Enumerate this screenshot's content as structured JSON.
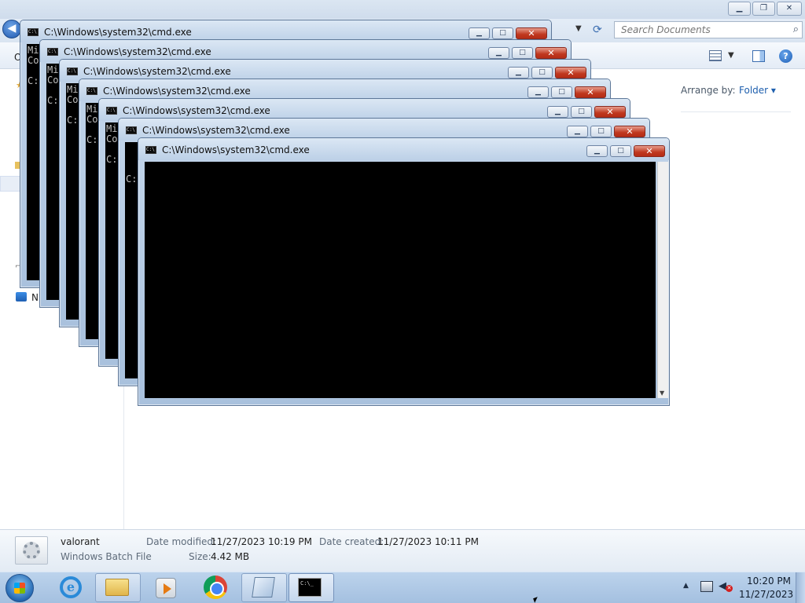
{
  "explorer": {
    "search_placeholder": "Search Documents",
    "organize_fragment": "O",
    "arrange_label": "Arrange by:",
    "arrange_value": "Folder",
    "nav_network_fragment": "N",
    "details": {
      "file_name": "valorant",
      "file_type": "Windows Batch File",
      "date_modified_label": "Date modified:",
      "date_modified": "11/27/2023 10:19 PM",
      "date_created_label": "Date created:",
      "date_created": "11/27/2023 10:11 PM",
      "size_label": "Size:",
      "size": "4.42 MB"
    }
  },
  "cmd_windows": [
    {
      "title": "C:\\Windows\\system32\\cmd.exe",
      "console": "Mi\nCo\n\nC:"
    },
    {
      "title": "C:\\Windows\\system32\\cmd.exe",
      "console": "Mi\nCo\n\nC:"
    },
    {
      "title": "C:\\Windows\\system32\\cmd.exe",
      "console": "Mi\nCo\n\nC:"
    },
    {
      "title": "C:\\Windows\\system32\\cmd.exe",
      "console": "Mi\nCo\n\nC:"
    },
    {
      "title": "C:\\Windows\\system32\\cmd.exe",
      "console": "Mi\nCo\n\nC:"
    },
    {
      "title": "C:\\Windows\\system32\\cmd.exe",
      "console": "\n\n\nC: Us"
    },
    {
      "title": "C:\\Windows\\system32\\cmd.exe",
      "console": ""
    }
  ],
  "taskbar": {
    "clock_time": "10:20 PM",
    "clock_date": "11/27/2023",
    "icons": [
      "start-orb-icon",
      "internet-explorer-icon",
      "file-explorer-icon",
      "media-player-icon",
      "chrome-icon",
      "notepad-icon",
      "cmd-icon"
    ]
  },
  "colors": {
    "titlebar": "#c1d4e9",
    "close_button": "#c0381f",
    "console_bg": "#000000",
    "taskbar": "#a4c0e0",
    "link_blue": "#1e5fae"
  }
}
